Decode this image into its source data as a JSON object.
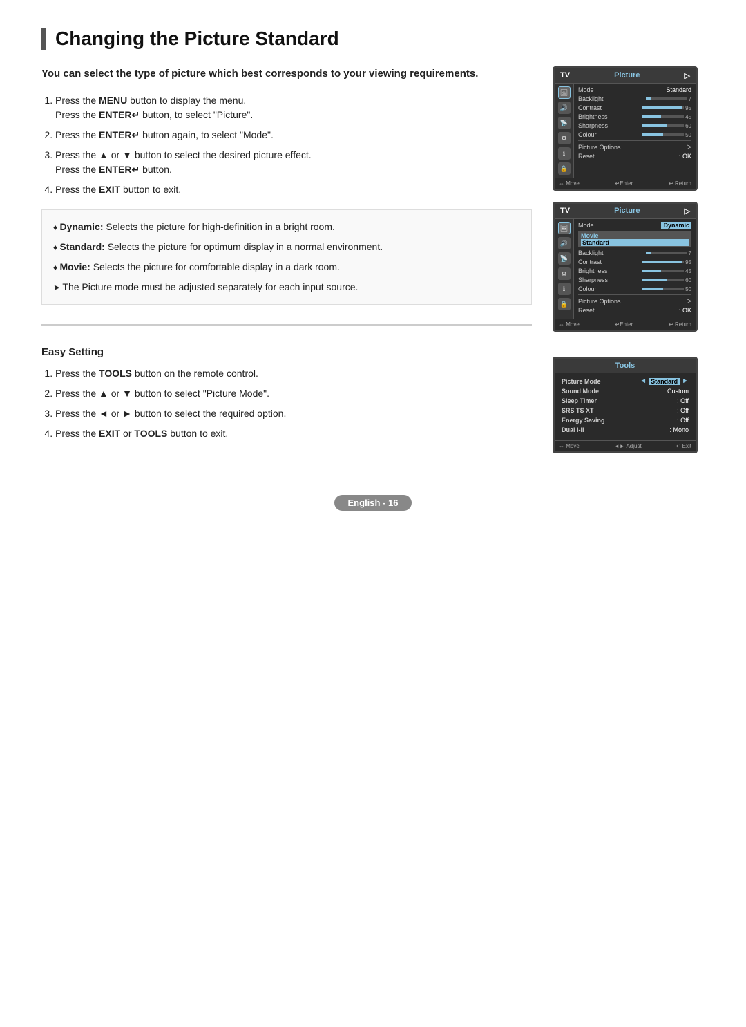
{
  "page": {
    "title": "Changing the Picture Standard",
    "footer": "English - 16"
  },
  "intro": {
    "text": "You can select the type of picture which best corresponds to your viewing requirements."
  },
  "main_steps": [
    {
      "id": 1,
      "text": "Press the ",
      "bold": "MENU",
      "text2": " button to display the menu.",
      "line2": "Press the ",
      "bold2": "ENTER",
      "text3": " button, to select \"Picture\"."
    },
    {
      "id": 2,
      "text": "Press the ",
      "bold": "ENTER",
      "text2": " button again, to select \"Mode\"."
    },
    {
      "id": 3,
      "text": "Press the ▲ or ▼ button to select the desired picture effect.",
      "line2": "Press the ",
      "bold2": "ENTER",
      "text3": " button."
    },
    {
      "id": 4,
      "text": "Press the ",
      "bold": "EXIT",
      "text2": " button to exit."
    }
  ],
  "bullets": [
    {
      "bold": "Dynamic:",
      "text": " Selects the picture for high-definition in a bright room."
    },
    {
      "bold": "Standard:",
      "text": " Selects the picture for optimum display in a normal environment."
    },
    {
      "bold": "Movie:",
      "text": " Selects the picture for comfortable display in a dark room."
    }
  ],
  "note": "The Picture mode must be adjusted separately for each input source.",
  "easy_setting": {
    "title": "Easy Setting",
    "steps": [
      {
        "id": 1,
        "text": "Press the ",
        "bold": "TOOLS",
        "text2": " button on the remote control."
      },
      {
        "id": 2,
        "text": "Press the ▲ or ▼ button to select \"Picture Mode\"."
      },
      {
        "id": 3,
        "text": "Press the ◄ or ► button to select the required option."
      },
      {
        "id": 4,
        "text": "Press the ",
        "bold": "EXIT",
        "text2": " or ",
        "bold2": "TOOLS",
        "text3": " button to exit."
      }
    ]
  },
  "tv_screen1": {
    "title": "Picture",
    "mode": "Standard",
    "rows": [
      {
        "label": "Mode",
        "value": "Standard",
        "type": "text"
      },
      {
        "label": "Backlight",
        "value": "7",
        "type": "slider",
        "fill": 20
      },
      {
        "label": "Contrast",
        "value": "95",
        "type": "slider",
        "fill": 95
      },
      {
        "label": "Brightness",
        "value": "45",
        "type": "slider",
        "fill": 45
      },
      {
        "label": "Sharpness",
        "value": "60",
        "type": "slider",
        "fill": 60
      },
      {
        "label": "Colour",
        "value": "50",
        "type": "slider",
        "fill": 50
      }
    ],
    "picture_options": "Picture Options",
    "reset": "Reset",
    "reset_value": ": OK",
    "footer": [
      "⇔ Move",
      "↵Enter",
      "↩ Return"
    ]
  },
  "tv_screen2": {
    "title": "Picture",
    "rows": [
      {
        "label": "Mode",
        "value": "Dynamic",
        "highlighted": true
      },
      {
        "label": "Backlight",
        "value": "7",
        "type": "slider",
        "fill": 20
      },
      {
        "label": "Contrast",
        "value": "95",
        "type": "slider",
        "fill": 95
      },
      {
        "label": "Brightness",
        "value": "45",
        "type": "slider",
        "fill": 45
      },
      {
        "label": "Sharpness",
        "value": "60",
        "type": "slider",
        "fill": 60
      },
      {
        "label": "Colour",
        "value": "50",
        "type": "slider",
        "fill": 50
      }
    ],
    "selected_mode": "Standard",
    "picture_options": "Picture Options",
    "reset": "Reset",
    "reset_value": ": OK",
    "footer": [
      "⇔ Move",
      "↵Enter",
      "↩ Return"
    ]
  },
  "tools_screen": {
    "title": "Tools",
    "rows": [
      {
        "label": "Picture Mode",
        "value": "Standard",
        "arrows": true
      },
      {
        "label": "Sound Mode",
        "value": ": Custom"
      },
      {
        "label": "Sleep Timer",
        "value": ": Off"
      },
      {
        "label": "SRS TS XT",
        "value": ": Off"
      },
      {
        "label": "Energy Saving",
        "value": ": Off"
      },
      {
        "label": "Dual I-II",
        "value": ": Mono"
      }
    ],
    "footer": [
      "⇔ Move",
      "◄► Adjust",
      "↩ Exit"
    ]
  }
}
